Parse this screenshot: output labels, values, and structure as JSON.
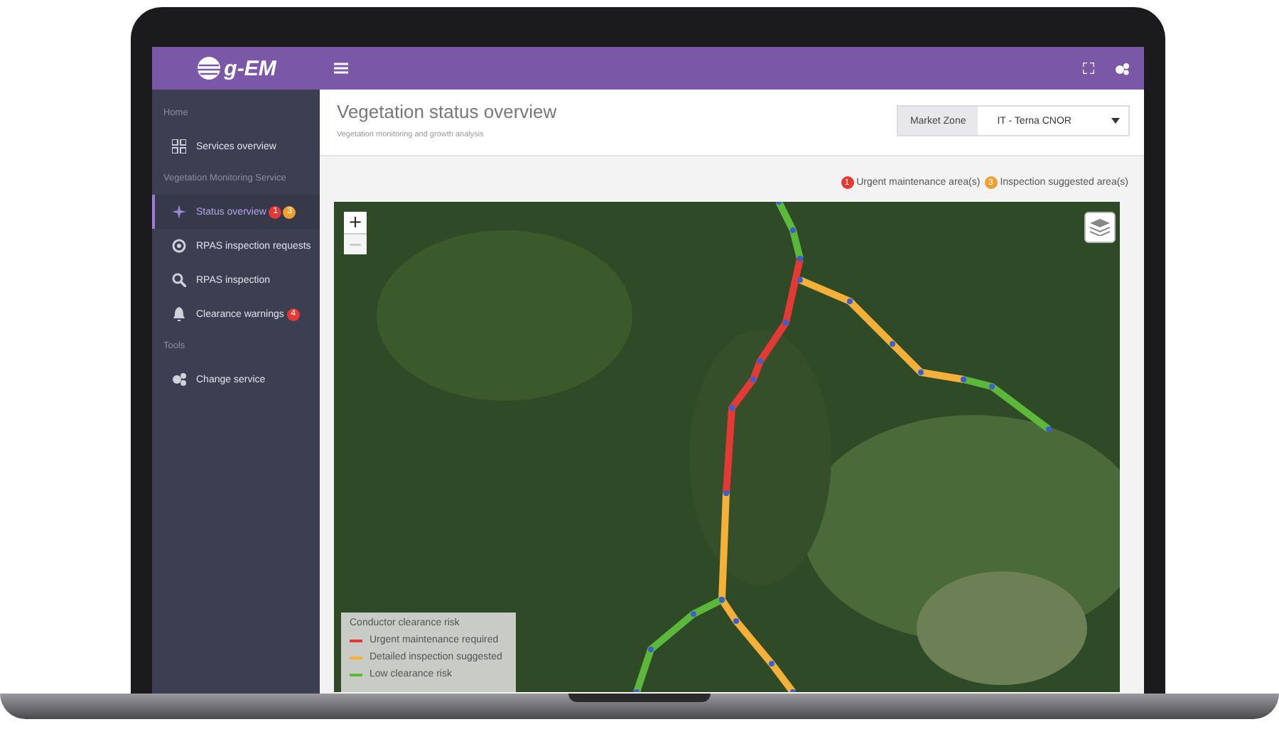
{
  "logo": {
    "text": "g-EM"
  },
  "sidebar": {
    "sections": [
      {
        "heading": "Home",
        "items": [
          {
            "label": "Services overview",
            "selected": false
          }
        ]
      },
      {
        "heading": "Vegetation Monitoring Service",
        "items": [
          {
            "label": "Status overview",
            "selected": true,
            "badges": [
              {
                "count": "1",
                "color": "#e53935"
              },
              {
                "count": "3",
                "color": "#f0a030"
              }
            ]
          },
          {
            "label": "RPAS inspection requests",
            "selected": false
          },
          {
            "label": "RPAS inspection",
            "selected": false
          },
          {
            "label": "Clearance warnings",
            "selected": false,
            "badges": [
              {
                "count": "4",
                "color": "#e53935"
              }
            ]
          }
        ]
      },
      {
        "heading": "Tools",
        "items": [
          {
            "label": "Change service",
            "selected": false
          }
        ]
      }
    ]
  },
  "header": {
    "title": "Vegetation status overview",
    "subtitle": "Vegetation monitoring and growth analysis",
    "market_zone": {
      "label": "Market Zone",
      "value": "IT - Terna CNOR"
    }
  },
  "alerts": [
    {
      "count": "1",
      "color": "#e53935",
      "label": "Urgent maintenance area(s)"
    },
    {
      "count": "3",
      "color": "#f0a030",
      "label": "Inspection suggested area(s)"
    }
  ],
  "map": {
    "zoom_in": {
      "label": "+",
      "disabled": false
    },
    "zoom_out": {
      "label": "−",
      "disabled": true
    },
    "legend": {
      "title": "Conductor clearance risk",
      "items": [
        {
          "label": "Urgent maintenance required",
          "color": "#e53935"
        },
        {
          "label": "Detailed inspection suggested",
          "color": "#f5b03a"
        },
        {
          "label": "Low clearance risk",
          "color": "#5cb83a"
        }
      ]
    }
  }
}
